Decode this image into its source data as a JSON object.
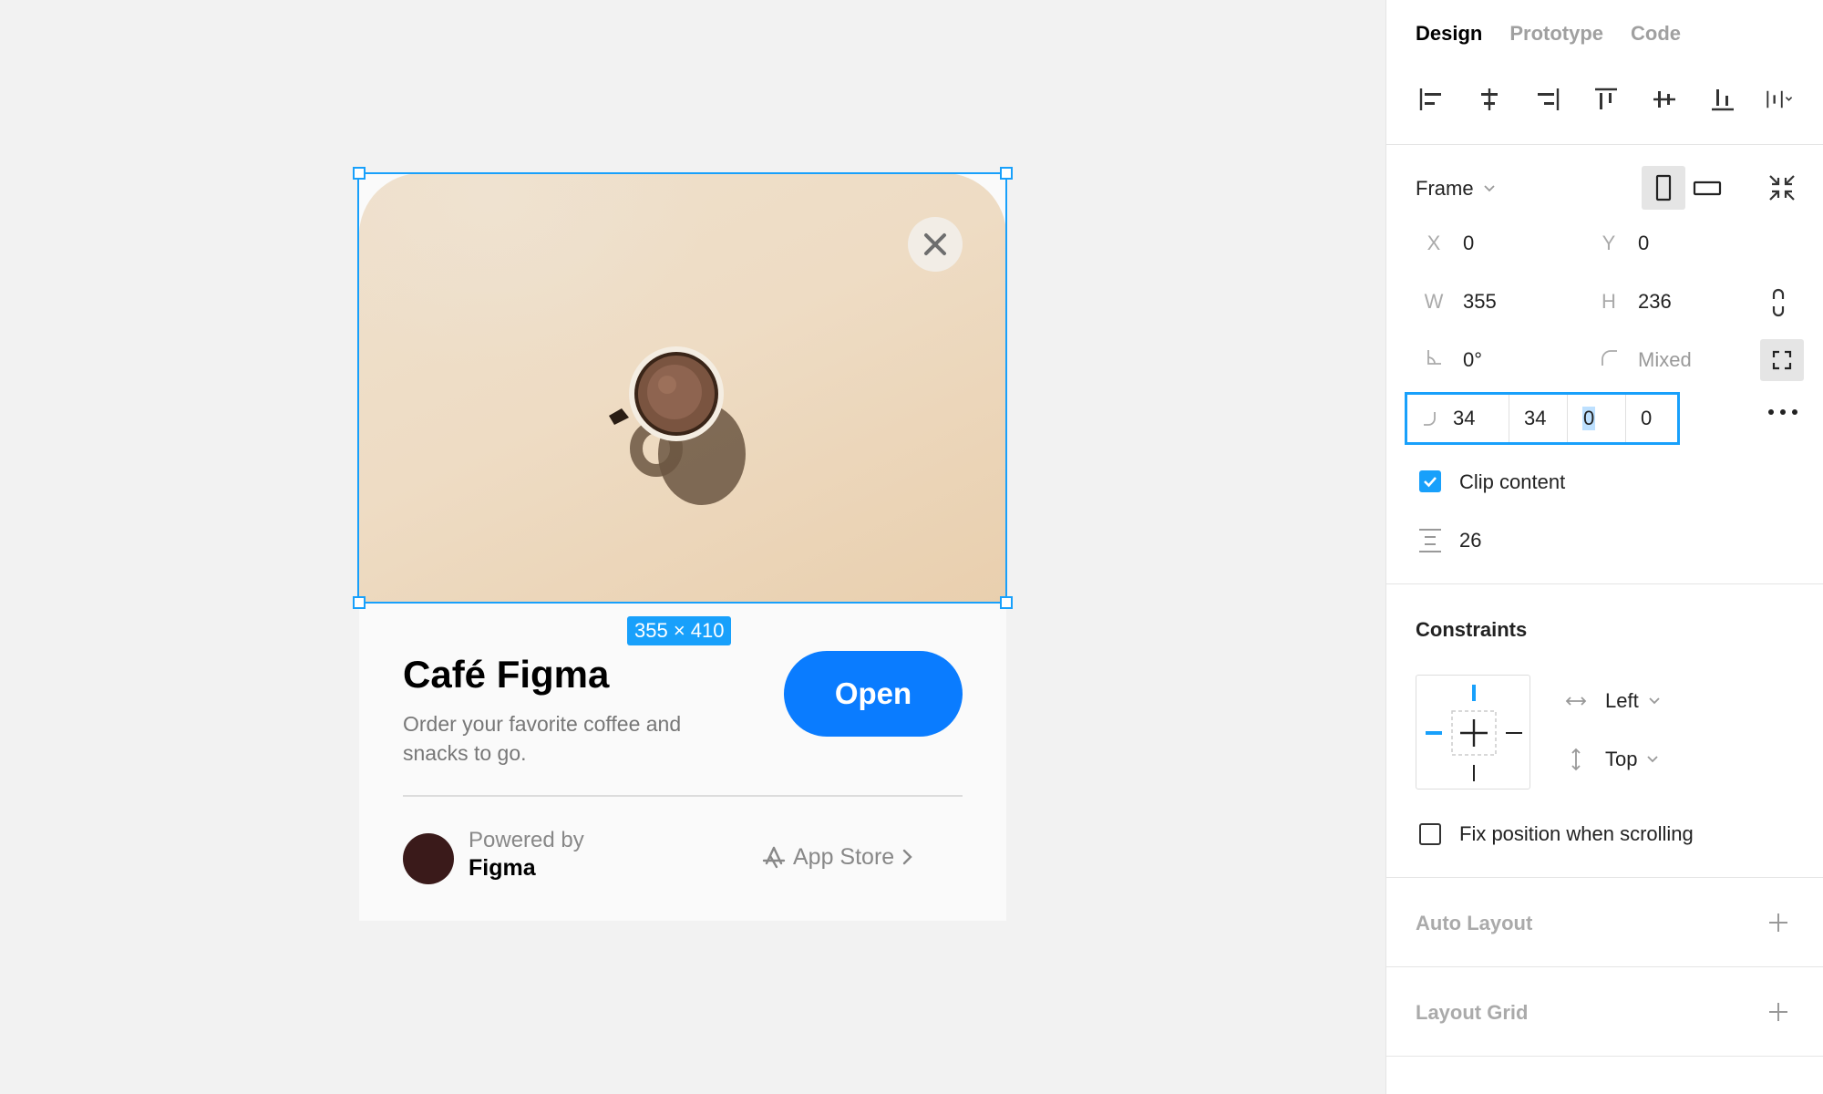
{
  "card": {
    "title": "Café Figma",
    "description": "Order your favorite coffee and snacks to go.",
    "open_label": "Open",
    "powered_by": "Powered by",
    "powered_name": "Figma",
    "app_store": "App Store"
  },
  "selection": {
    "dimensions": "355 × 410"
  },
  "panel": {
    "tabs": [
      "Design",
      "Prototype",
      "Code"
    ],
    "frame_label": "Frame",
    "x_label": "X",
    "x_value": "0",
    "y_label": "Y",
    "y_value": "0",
    "w_label": "W",
    "w_value": "355",
    "h_label": "H",
    "h_value": "236",
    "rotation_value": "0°",
    "radius_value": "Mixed",
    "corner_radii": [
      "34",
      "34",
      "0",
      "0"
    ],
    "clip_content": "Clip content",
    "spacing_value": "26",
    "constraints_title": "Constraints",
    "horizontal_constraint": "Left",
    "vertical_constraint": "Top",
    "fix_position": "Fix position when scrolling",
    "auto_layout": "Auto Layout",
    "layout_grid": "Layout Grid"
  },
  "colors": {
    "accent": "#18a0fb",
    "open_button": "#0a7cff"
  }
}
